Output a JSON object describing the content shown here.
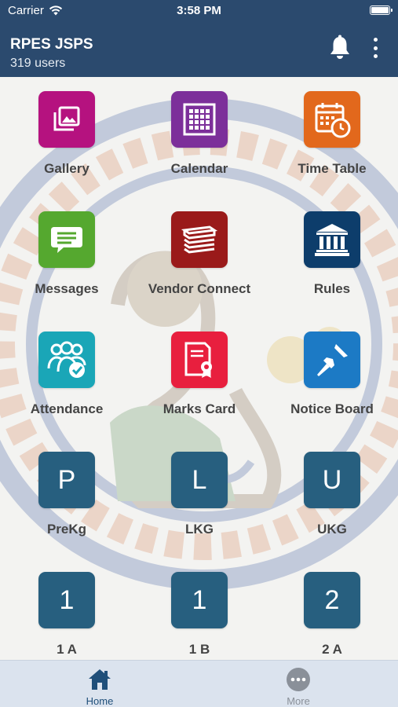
{
  "status_bar": {
    "carrier": "Carrier",
    "time": "3:58 PM"
  },
  "header": {
    "title": "RPES JSPS",
    "subtitle": "319 users"
  },
  "tiles": [
    {
      "label": "Gallery",
      "color": "#b5127f",
      "icon": "image-gallery-icon"
    },
    {
      "label": "Calendar",
      "color": "#7c2f9a",
      "icon": "calendar-icon"
    },
    {
      "label": "Time Table",
      "color": "#e2681c",
      "icon": "timetable-icon"
    },
    {
      "label": "Messages",
      "color": "#55a82f",
      "icon": "message-bubble-icon"
    },
    {
      "label": "Vendor Connect",
      "color": "#9a1a1a",
      "icon": "books-icon"
    },
    {
      "label": "Rules",
      "color": "#0d3d6b",
      "icon": "courthouse-icon"
    },
    {
      "label": "Attendance",
      "color": "#1aa6b7",
      "icon": "group-check-icon"
    },
    {
      "label": "Marks Card",
      "color": "#e81f3e",
      "icon": "certificate-icon"
    },
    {
      "label": "Notice Board",
      "color": "#1c7ac5",
      "icon": "pushpin-icon"
    },
    {
      "label": "PreKg",
      "letter": "P",
      "color": "#275f7f"
    },
    {
      "label": "LKG",
      "letter": "L",
      "color": "#275f7f"
    },
    {
      "label": "UKG",
      "letter": "U",
      "color": "#275f7f"
    },
    {
      "label": "1 A",
      "letter": "1",
      "color": "#275f7f"
    },
    {
      "label": "1 B",
      "letter": "1",
      "color": "#275f7f"
    },
    {
      "label": "2 A",
      "letter": "2",
      "color": "#275f7f"
    }
  ],
  "tab_bar": {
    "home_label": "Home",
    "more_label": "More",
    "active_color": "#1f4f7a",
    "inactive_color": "#8a9099"
  }
}
